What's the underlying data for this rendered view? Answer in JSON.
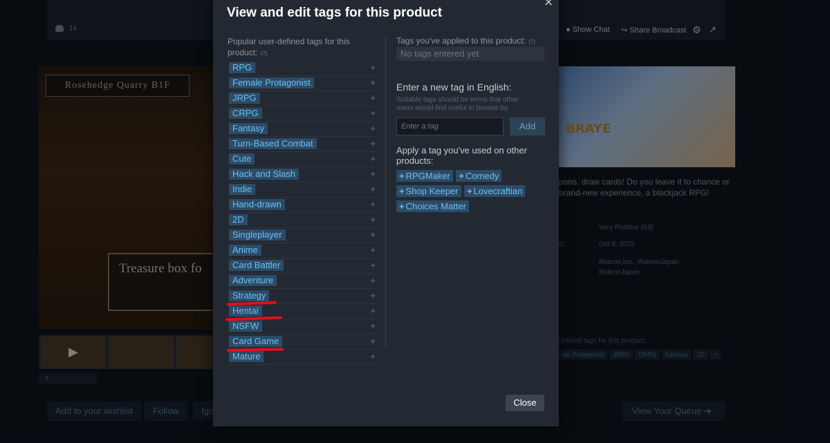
{
  "background": {
    "viewer_count": "14",
    "show_chat": "Show Chat",
    "share_broadcast": "Share Broadcast",
    "location_banner": "Rosehedge Quarry  B1F",
    "dialog_text": "Treasure box fo",
    "capsule_logo": "Braye\nFUNCTION",
    "description": "pons, draw cards! Do you leave it to chance or brand-new experience, a blackjack RPG!",
    "reviews_value": "Very Positive (53)",
    "release_key": "E:",
    "release_value": "Oct 8, 2025",
    "developer_value": "Rideon,Inc., RideonJapan",
    "publisher_value": "RideonJapan",
    "tags_row_label": "defined tags for this product:",
    "tags_row": [
      "ale Protagonist",
      "JRPG",
      "CRPG",
      "Fantasy",
      "2D",
      "+"
    ],
    "wishlist_button": "Add to your wishlist",
    "follow_button": "Follow",
    "ignore_button": "Ign",
    "queue_button": "View Your Queue"
  },
  "modal": {
    "title": "View and edit tags for this product",
    "popular_label": "Popular user-defined tags for this product:",
    "help_mark": "(?)",
    "popular_tags": [
      "RPG",
      "Female Protagonist",
      "JRPG",
      "CRPG",
      "Fantasy",
      "Turn-Based Combat",
      "Cute",
      "Hack and Slash",
      "Indie",
      "Hand-drawn",
      "2D",
      "Singleplayer",
      "Anime",
      "Card Battler",
      "Adventure",
      "Strategy",
      "Hentai",
      "NSFW",
      "Card Game",
      "Mature"
    ],
    "applied_label": "Tags you've applied to this product:",
    "applied_empty": "No tags entered yet",
    "new_tag_title": "Enter a new tag in English:",
    "new_tag_hint": "Suitable tags should be terms that other users would find useful to browse by.",
    "input_placeholder": "Enter a tag",
    "add_label": "Add",
    "apply_title": "Apply a tag you've used on other products:",
    "apply_tags": [
      "RPGMaker",
      "Comedy",
      "Shop Keeper",
      "Lovecraftian",
      "Choices Matter"
    ],
    "close_label": "Close",
    "underlined_tags": [
      "Hentai",
      "NSFW",
      "Mature"
    ]
  },
  "colors": {
    "accent": "#67c1f5",
    "tag_bg": "#2d4b66",
    "modal_bg": "#232932",
    "annotation": "#e0101a"
  }
}
